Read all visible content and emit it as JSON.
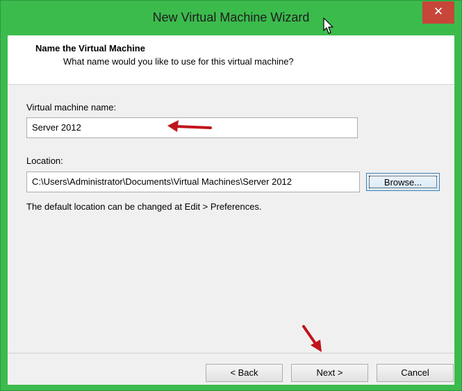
{
  "window": {
    "title": "New Virtual Machine Wizard",
    "close_glyph": "✕",
    "accent_color": "#3cbb4d"
  },
  "header": {
    "title": "Name the Virtual Machine",
    "subtitle": "What name would you like to use for this virtual machine?"
  },
  "form": {
    "name_label": "Virtual machine name:",
    "name_value": "Server 2012",
    "location_label": "Location:",
    "location_value": "C:\\Users\\Administrator\\Documents\\Virtual Machines\\Server 2012",
    "browse_label": "Browse...",
    "hint": "The default location can be changed at Edit > Preferences."
  },
  "footer": {
    "back_label": "< Back",
    "next_label": "Next >",
    "cancel_label": "Cancel"
  },
  "annotations": {
    "arrow_color": "#c0141c"
  }
}
